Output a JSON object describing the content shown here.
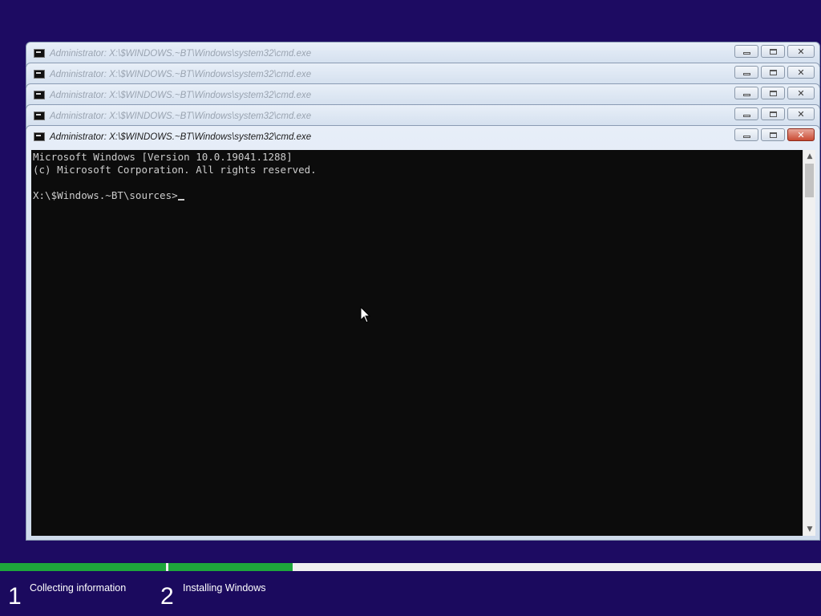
{
  "background_windows": [
    {
      "title": "Administrator: X:\\$WINDOWS.~BT\\Windows\\system32\\cmd.exe"
    },
    {
      "title": "Administrator: X:\\$WINDOWS.~BT\\Windows\\system32\\cmd.exe"
    },
    {
      "title": "Administrator: X:\\$WINDOWS.~BT\\Windows\\system32\\cmd.exe"
    },
    {
      "title": "Administrator: X:\\$WINDOWS.~BT\\Windows\\system32\\cmd.exe"
    }
  ],
  "active_window": {
    "title": "Administrator: X:\\$WINDOWS.~BT\\Windows\\system32\\cmd.exe",
    "console_lines": [
      "Microsoft Windows [Version 10.0.19041.1288]",
      "(c) Microsoft Corporation. All rights reserved.",
      "",
      "X:\\$Windows.~BT\\sources>"
    ]
  },
  "setup": {
    "steps": [
      {
        "number": "1",
        "label": "Collecting information"
      },
      {
        "number": "2",
        "label": "Installing Windows"
      }
    ]
  },
  "colors": {
    "desktop": "#1d0b62",
    "console_bg": "#0c0c0c",
    "console_fg": "#cccccc",
    "progress": "#1ea63b"
  },
  "icons": [
    "cmd-icon",
    "minimize-icon",
    "maximize-icon",
    "close-icon",
    "scroll-up-icon",
    "scroll-down-icon",
    "mouse-pointer-icon"
  ]
}
